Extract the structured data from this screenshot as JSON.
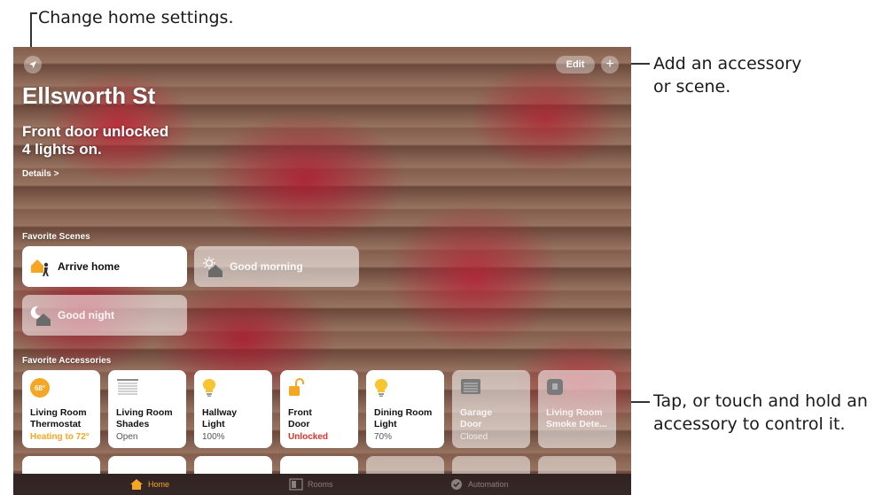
{
  "callouts": {
    "settings": "Change home settings.",
    "add_line1": "Add an accessory",
    "add_line2": "or scene.",
    "tap_line1": "Tap, or touch and hold an",
    "tap_line2": "accessory to control it."
  },
  "toolbar": {
    "edit_label": "Edit",
    "add_label": "+"
  },
  "home": {
    "title": "Ellsworth St",
    "status_line1": "Front door unlocked",
    "status_line2": "4 lights on.",
    "details_label": "Details >"
  },
  "scenes": {
    "section_label": "Favorite Scenes",
    "items": [
      {
        "label": "Arrive home",
        "active": true
      },
      {
        "label": "Good morning",
        "active": false
      },
      {
        "label": "Good night",
        "active": false
      }
    ]
  },
  "accessories": {
    "section_label": "Favorite Accessories",
    "items": [
      {
        "name": "Living Room Thermostat",
        "state": "Heating to 72°",
        "badge": "68°",
        "icon": "thermostat-icon",
        "active": true
      },
      {
        "name": "Living Room Shades",
        "state": "Open",
        "icon": "shades-icon",
        "active": true
      },
      {
        "name": "Hallway Light",
        "state": "100%",
        "icon": "lightbulb-icon",
        "active": true
      },
      {
        "name": "Front Door",
        "state": "Unlocked",
        "icon": "lock-open-icon",
        "active": true
      },
      {
        "name": "Dining Room Light",
        "state": "70%",
        "icon": "lightbulb-icon",
        "active": true
      },
      {
        "name": "Garage Door",
        "state": "Closed",
        "icon": "garage-icon",
        "active": false
      },
      {
        "name": "Living Room Smoke Dete...",
        "state": "",
        "icon": "smoke-detector-icon",
        "active": false
      }
    ]
  },
  "tabs": [
    {
      "label": "Home",
      "active": true
    },
    {
      "label": "Rooms",
      "active": false
    },
    {
      "label": "Automation",
      "active": false
    }
  ],
  "colors": {
    "accent": "#f5a623",
    "alert": "#e0322a",
    "tabbar": "#2a1f1f"
  }
}
